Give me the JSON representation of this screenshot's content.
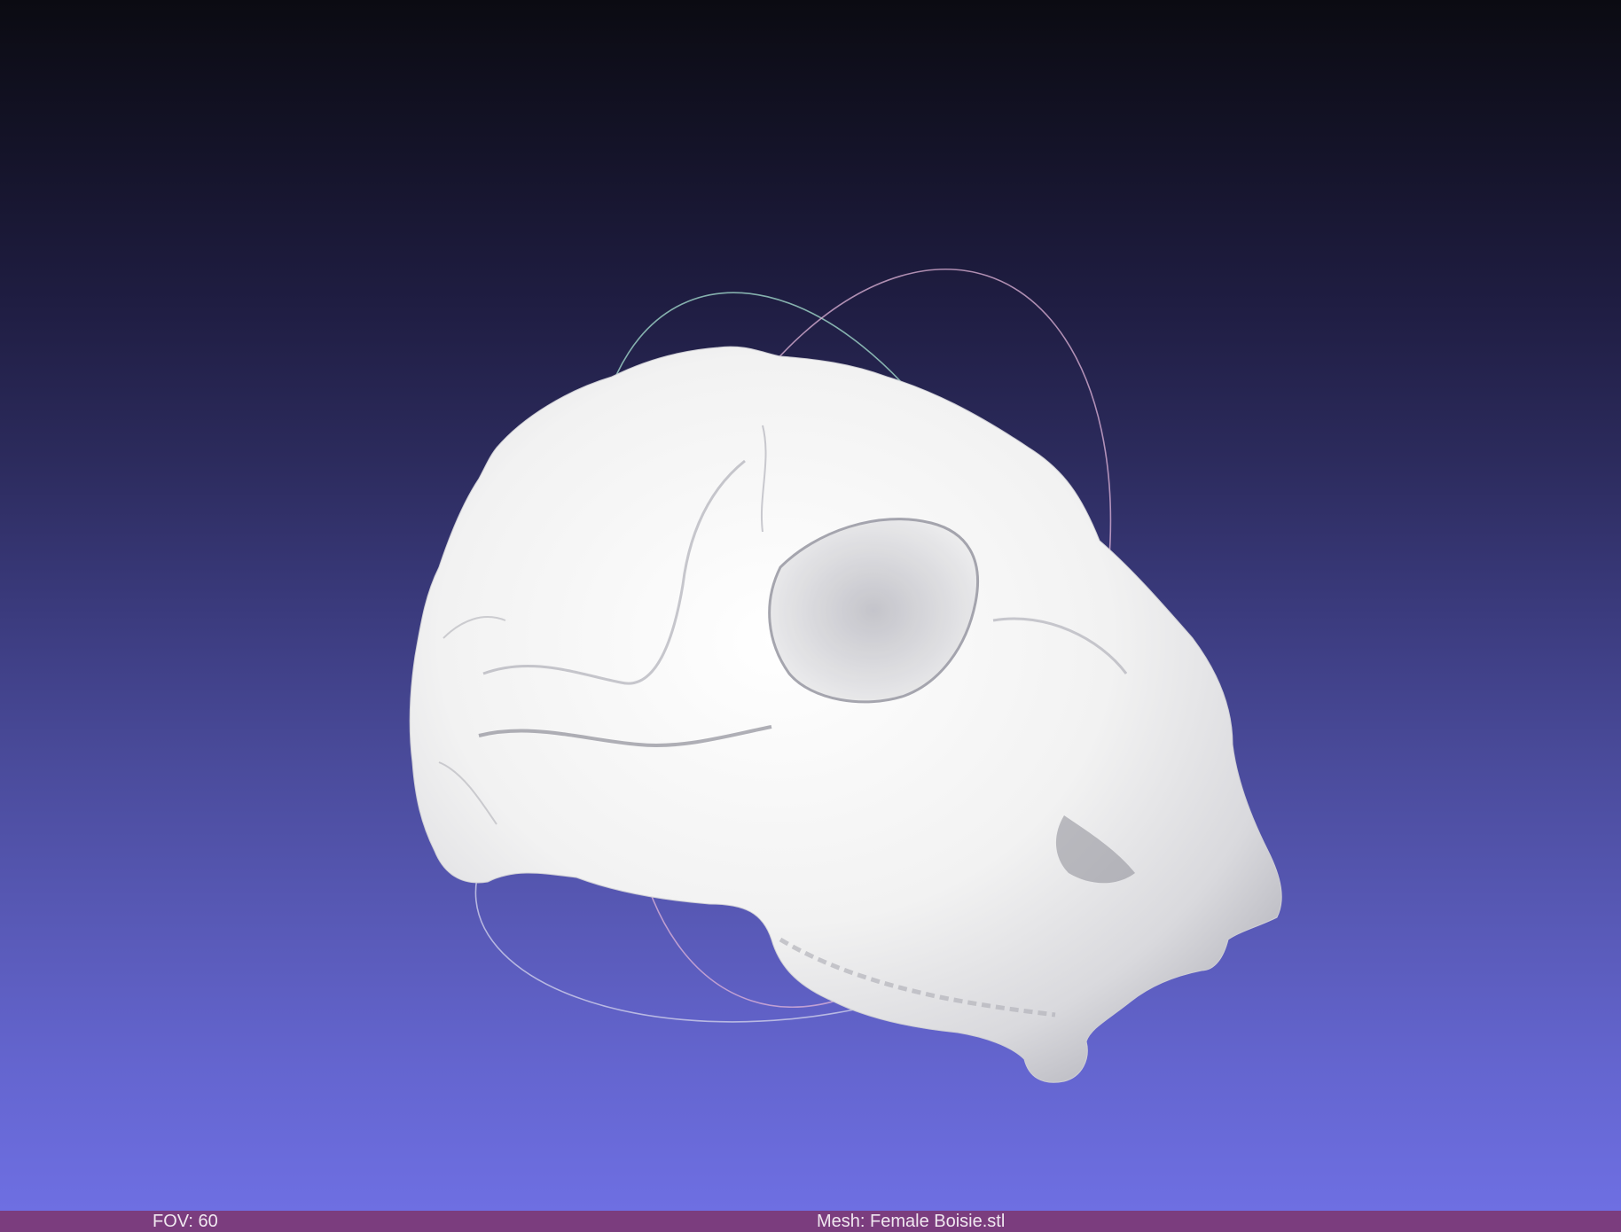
{
  "viewer": {
    "background_top_color": "#0b0b12",
    "background_bottom_color": "#6e6fe2",
    "model_color": "#f2f2f2",
    "trackball": {
      "ring_colors": [
        "#9fd6c8",
        "#e0b4d8",
        "#c8c8e8"
      ]
    }
  },
  "status_bar": {
    "color": "#7b3d7e",
    "fov_label": "FOV: 60",
    "mesh_label": "Mesh: Female Boisie.stl"
  }
}
